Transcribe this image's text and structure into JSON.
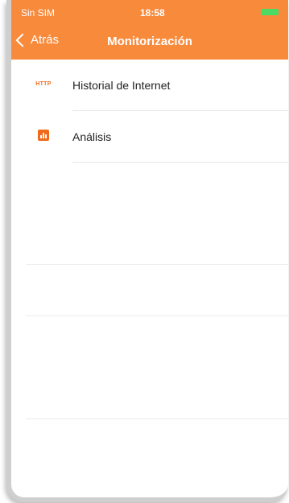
{
  "status_bar": {
    "carrier": "Sin SIM",
    "time": "18:58"
  },
  "nav": {
    "back_label": "Atrás",
    "title": "Monitorización"
  },
  "list": {
    "items": [
      {
        "icon": "http-icon",
        "label": "Historial de Internet"
      },
      {
        "icon": "bar-chart-icon",
        "label": "Análisis"
      }
    ]
  },
  "colors": {
    "accent": "#f88a3c",
    "icon": "#f06a1a"
  }
}
